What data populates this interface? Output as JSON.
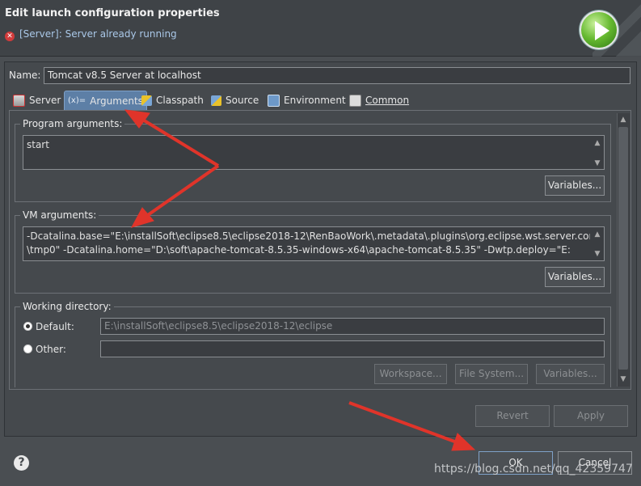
{
  "window": {
    "title": "Edit launch configuration properties",
    "status_message": "[Server]: Server already running",
    "status_icon": "error-icon",
    "header_icon": "run-play-icon"
  },
  "name": {
    "label": "Name:",
    "value": "Tomcat v8.5 Server at localhost"
  },
  "tabs": [
    {
      "label": "Server",
      "icon": "server-icon"
    },
    {
      "label": "Arguments",
      "prefix": "(x)=",
      "icon": "variable-icon",
      "selected": true
    },
    {
      "label": "Classpath",
      "icon": "classpath-icon"
    },
    {
      "label": "Source",
      "icon": "source-icon"
    },
    {
      "label": "Environment",
      "icon": "environment-icon"
    },
    {
      "label": "Common",
      "icon": "common-icon"
    }
  ],
  "program_arguments": {
    "title": "Program arguments:",
    "value": "start",
    "variables_label": "Variables..."
  },
  "vm_arguments": {
    "title": "VM arguments:",
    "line1": "-Dcatalina.base=\"E:\\installSoft\\eclipse8.5\\eclipse2018-12\\RenBaoWork\\.metadata\\.plugins\\org.eclipse.wst.server.core",
    "line2": "\\tmp0\" -Dcatalina.home=\"D:\\soft\\apache-tomcat-8.5.35-windows-x64\\apache-tomcat-8.5.35\" -Dwtp.deploy=\"E:",
    "variables_label": "Variables..."
  },
  "working_directory": {
    "title": "Working directory:",
    "default_label": "Default:",
    "default_value": "E:\\installSoft\\eclipse8.5\\eclipse2018-12\\eclipse",
    "default_selected": true,
    "other_label": "Other:",
    "other_value": "",
    "workspace_label": "Workspace...",
    "filesystem_label": "File System...",
    "variables_label": "Variables..."
  },
  "actions": {
    "revert_label": "Revert",
    "apply_label": "Apply",
    "ok_label": "OK",
    "cancel_label": "Cancel"
  },
  "help_icon": "help-icon",
  "watermark": "https://blog.csdn.net/qq_42359747",
  "colors": {
    "background": "#4a4e52",
    "selected_tab": "#5d7fa6",
    "annotation_arrow": "#e0342a"
  }
}
